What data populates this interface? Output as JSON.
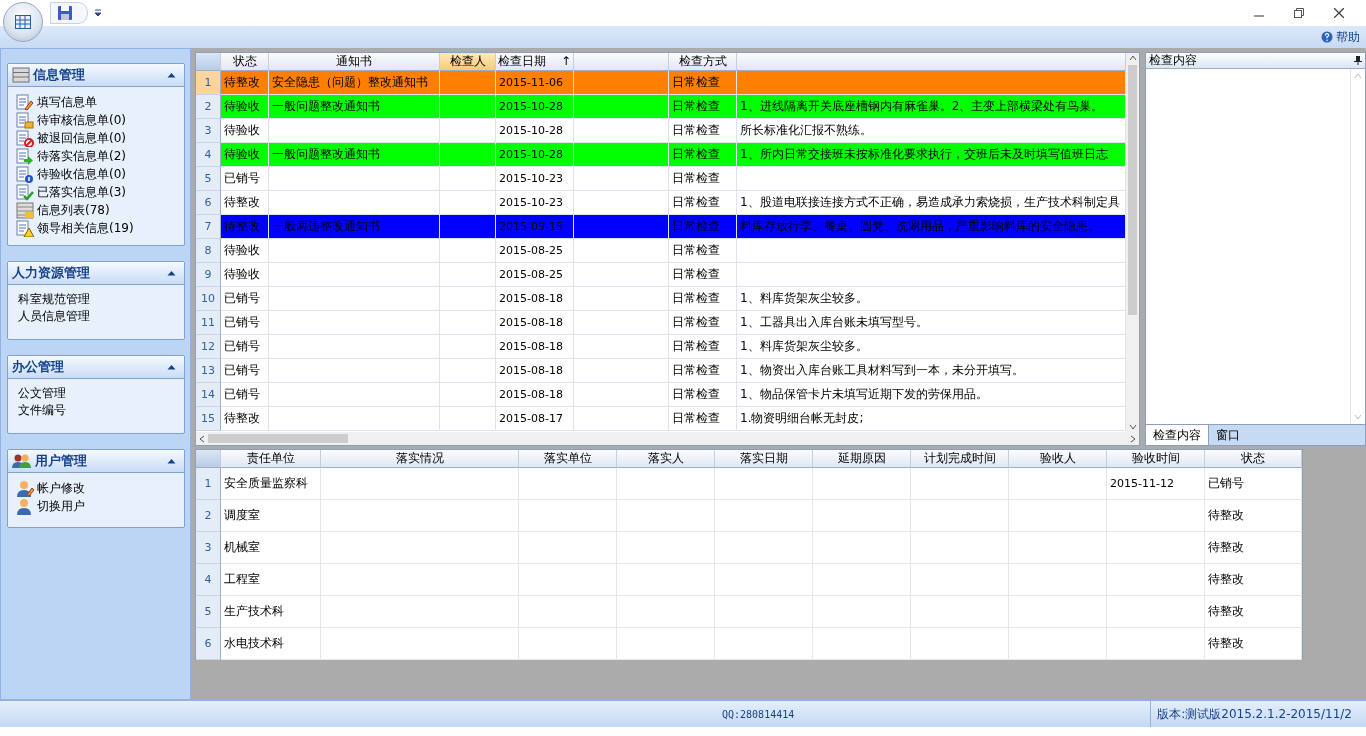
{
  "help": {
    "label": "帮助"
  },
  "sidebar": {
    "groups": [
      {
        "title": "信息管理",
        "expanded": true,
        "items": [
          {
            "label": "填写信息单"
          },
          {
            "label": "待审核信息单(0)"
          },
          {
            "label": "被退回信息单(0)"
          },
          {
            "label": "待落实信息单(2)"
          },
          {
            "label": "待验收信息单(0)"
          },
          {
            "label": "已落实信息单(3)"
          },
          {
            "label": "信息列表(78)"
          },
          {
            "label": "领导相关信息(19)"
          }
        ]
      },
      {
        "title": "人力资源管理",
        "expanded": true,
        "items": [
          {
            "label": "科室规范管理"
          },
          {
            "label": "人员信息管理"
          }
        ]
      },
      {
        "title": "办公管理",
        "expanded": true,
        "items": [
          {
            "label": "公文管理"
          },
          {
            "label": "文件编号"
          }
        ]
      },
      {
        "title": "用户管理",
        "expanded": true,
        "items": [
          {
            "label": "帐户修改"
          },
          {
            "label": "切换用户"
          }
        ]
      }
    ]
  },
  "table": {
    "columns": [
      {
        "label": "状态",
        "selected": false
      },
      {
        "label": "通知书",
        "selected": false
      },
      {
        "label": "检查人",
        "selected": true
      },
      {
        "label": "检查日期",
        "sort": "↑",
        "selected": false
      },
      {
        "selected": false
      },
      {
        "label": "检查方式",
        "selected": false
      },
      {
        "selected": false
      }
    ],
    "rows": [
      {
        "number": "1",
        "selected": true,
        "color": "#ff8000",
        "cells": [
          "待整改",
          "安全隐患（问题）整改通知书",
          "",
          "2015-11-06",
          "",
          "日常检查",
          ""
        ]
      },
      {
        "number": "2",
        "selected": false,
        "color": "#00ff00",
        "cells": [
          "待验收",
          "一般问题整改通知书",
          "",
          "2015-10-28",
          "",
          "日常检查",
          "1、进线隔离开关底座槽钢内有麻雀巢。2、主变上部横梁处有鸟巢。"
        ]
      },
      {
        "number": "3",
        "selected": false,
        "cells": [
          "待验收",
          "",
          "",
          "2015-10-28",
          "",
          "日常检查",
          "所长标准化汇报不熟练。"
        ]
      },
      {
        "number": "4",
        "selected": false,
        "color": "#00ff00",
        "cells": [
          "待验收",
          "一般问题整改通知书",
          "",
          "2015-10-28",
          "",
          "日常检查",
          "1、所内日常交接班未按标准化要求执行，交班后未及时填写值班日志"
        ]
      },
      {
        "number": "5",
        "selected": false,
        "cells": [
          "已销号",
          "",
          "",
          "2015-10-23",
          "",
          "日常检查",
          ""
        ]
      },
      {
        "number": "6",
        "selected": false,
        "cells": [
          "待整改",
          "",
          "",
          "2015-10-23",
          "",
          "日常检查",
          "1、股道电联接连接方式不正确，易造成承力索烧损，生产技术科制定具"
        ]
      },
      {
        "number": "7",
        "selected": false,
        "color": "#0000ff",
        "cells": [
          "待整改",
          "一般两违整改通知书",
          "",
          "2015-09-15",
          "",
          "日常检查",
          "料库存放行李、餐桌、圆凳、洗涮用品，严重影响料库的安全隐患。"
        ]
      },
      {
        "number": "8",
        "selected": false,
        "cells": [
          "待验收",
          "",
          "",
          "2015-08-25",
          "",
          "日常检查",
          ""
        ]
      },
      {
        "number": "9",
        "selected": false,
        "cells": [
          "待验收",
          "",
          "",
          "2015-08-25",
          "",
          "日常检查",
          ""
        ]
      },
      {
        "number": "10",
        "selected": false,
        "cells": [
          "已销号",
          "",
          "",
          "2015-08-18",
          "",
          "日常检查",
          "1、料库货架灰尘较多。"
        ]
      },
      {
        "number": "11",
        "selected": false,
        "cells": [
          "已销号",
          "",
          "",
          "2015-08-18",
          "",
          "日常检查",
          "1、工器具出入库台账未填写型号。"
        ]
      },
      {
        "number": "12",
        "selected": false,
        "cells": [
          "已销号",
          "",
          "",
          "2015-08-18",
          "",
          "日常检查",
          "1、料库货架灰尘较多。"
        ]
      },
      {
        "number": "13",
        "selected": false,
        "cells": [
          "已销号",
          "",
          "",
          "2015-08-18",
          "",
          "日常检查",
          "1、物资出入库台账工具材料写到一本，未分开填写。"
        ]
      },
      {
        "number": "14",
        "selected": false,
        "cells": [
          "已销号",
          "",
          "",
          "2015-08-18",
          "",
          "日常检查",
          "1、物品保管卡片未填写近期下发的劳保用品。"
        ]
      },
      {
        "number": "15",
        "selected": false,
        "cells": [
          "待整改",
          "",
          "",
          "2015-08-17",
          "",
          "日常检查",
          "1.物资明细台帐无封皮;"
        ]
      }
    ]
  },
  "detail_panel": {
    "title": "检查内容",
    "tabs": [
      {
        "label": "检查内容",
        "selected": true
      },
      {
        "label": "窗口",
        "selected": false
      }
    ]
  },
  "sub_table": {
    "columns": [
      "责任单位",
      "落实情况",
      "落实单位",
      "落实人",
      "落实日期",
      "延期原因",
      "计划完成时间",
      "验收人",
      "验收时间",
      "状态"
    ],
    "rows": [
      {
        "number": "1",
        "cells": [
          "安全质量监察科",
          "",
          "",
          "",
          "",
          "",
          "",
          "",
          "2015-11-12",
          "已销号"
        ]
      },
      {
        "number": "2",
        "cells": [
          "调度室",
          "",
          "",
          "",
          "",
          "",
          "",
          "",
          "",
          "待整改"
        ]
      },
      {
        "number": "3",
        "cells": [
          "机械室",
          "",
          "",
          "",
          "",
          "",
          "",
          "",
          "",
          "待整改"
        ]
      },
      {
        "number": "4",
        "cells": [
          "工程室",
          "",
          "",
          "",
          "",
          "",
          "",
          "",
          "",
          "待整改"
        ]
      },
      {
        "number": "5",
        "cells": [
          "生产技术科",
          "",
          "",
          "",
          "",
          "",
          "",
          "",
          "",
          "待整改"
        ]
      },
      {
        "number": "6",
        "cells": [
          "水电技术科",
          "",
          "",
          "",
          "",
          "",
          "",
          "",
          "",
          "待整改"
        ]
      }
    ]
  },
  "status_bar": {
    "contact": "QQ:280814414",
    "version": "版本:测试版2015.2.1.2-2015/11/2"
  }
}
